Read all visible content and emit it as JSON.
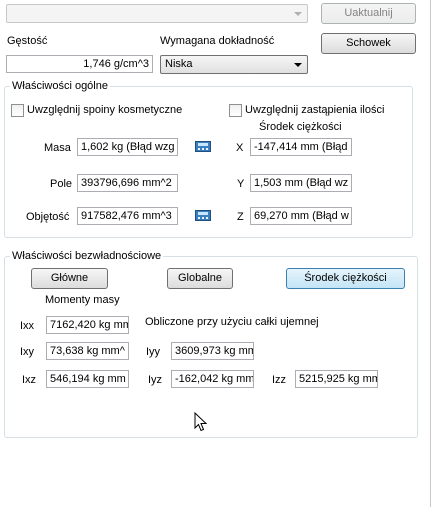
{
  "top": {
    "selection_combo": "",
    "update_button": "Uaktualnij",
    "density_label": "Gęstość",
    "density_value": "1,746 g/cm^3",
    "accuracy_label": "Wymagana dokładność",
    "accuracy_value": "Niska",
    "clipboard_button": "Schowek"
  },
  "general": {
    "title": "Właściwości ogólne",
    "include_cosmetic_welds": "Uwzględnij spoiny kosmetyczne",
    "include_overrides": "Uwzględnij zastąpienia ilości",
    "center_of_gravity_label": "Środek ciężkości",
    "mass_label": "Masa",
    "mass_value": "1,602 kg (Błąd wzg",
    "area_label": "Pole",
    "area_value": "393796,696 mm^2",
    "volume_label": "Objętość",
    "volume_value": "917582,476 mm^3",
    "x_label": "X",
    "x_value": "-147,414 mm (Błąd",
    "y_label": "Y",
    "y_value": "1,503 mm (Błąd wz",
    "z_label": "Z",
    "z_value": "69,270 mm (Błąd w"
  },
  "inertial": {
    "title": "Właściwości bezwładnościowe",
    "principal_button": "Główne",
    "global_button": "Globalne",
    "center_button": "Środek ciężkości",
    "moments_label": "Momenty masy",
    "note": "Obliczone przy użyciu całki ujemnej",
    "ixx_label": "Ixx",
    "ixx_value": "7162,420 kg mm",
    "ixy_label": "Ixy",
    "ixy_value": "73,638 kg mm^",
    "iyy_label": "Iyy",
    "iyy_value": "3609,973 kg mm",
    "ixz_label": "Ixz",
    "ixz_value": "546,194 kg mm",
    "iyz_label": "Iyz",
    "iyz_value": "-162,042 kg mm",
    "izz_label": "Izz",
    "izz_value": "5215,925 kg mm"
  },
  "icons": {
    "calculator": "calculator-icon",
    "cursor": "mouse-pointer-icon"
  }
}
